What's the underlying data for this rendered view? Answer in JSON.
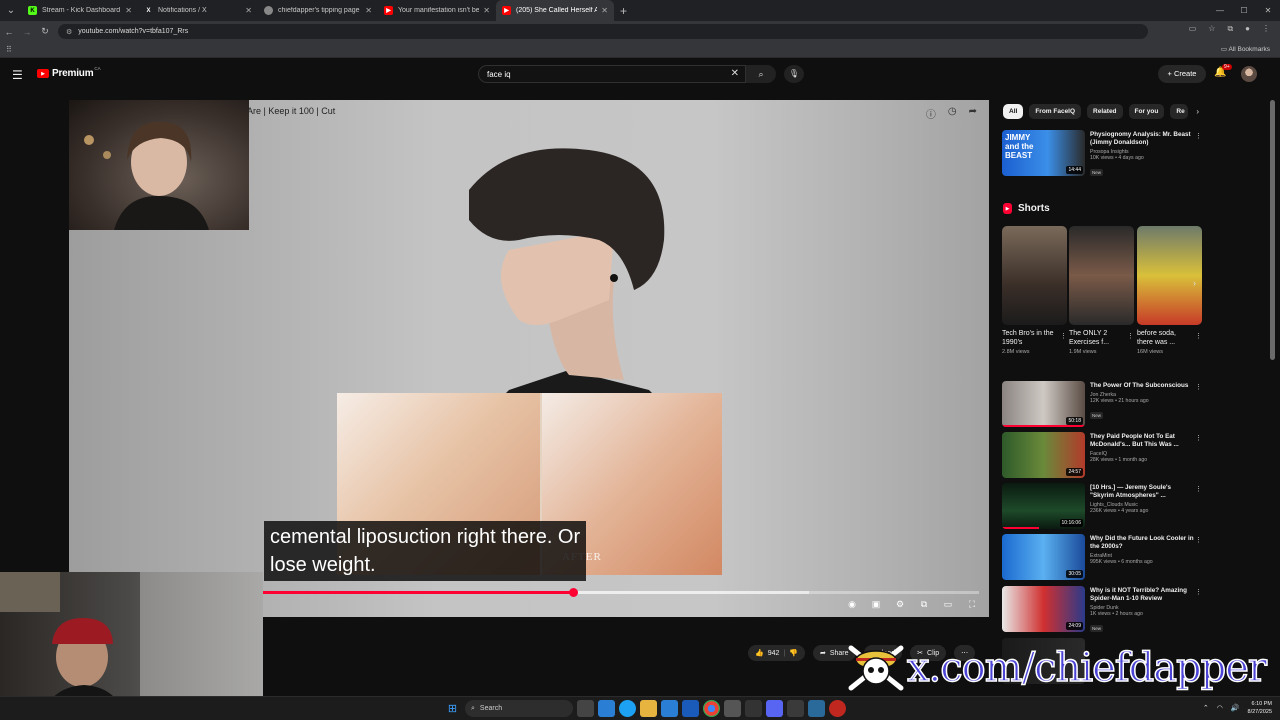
{
  "browser": {
    "tabs": [
      {
        "title": "Stream - Kick Dashboard",
        "icon": "K",
        "color": "#53fc18"
      },
      {
        "title": "Notifications / X",
        "icon": "X",
        "color": "#ffffff"
      },
      {
        "title": "chiefdapper's tipping page",
        "icon": "",
        "color": "#888888"
      },
      {
        "title": "Your manifestation isn't being",
        "icon": "▶",
        "color": "#ff0000"
      },
      {
        "title": "(205) She Called Herself A",
        "icon": "▶",
        "color": "#ff0000"
      }
    ],
    "url": "youtube.com/watch?v=tbfa107_Rrs",
    "all_bookmarks": "All Bookmarks"
  },
  "youtube": {
    "logo_text": "Premium",
    "region": "CA",
    "search_value": "face iq",
    "create_label": "Create",
    "notif_badge": "9+"
  },
  "player": {
    "title_fragment": "Are | Keep it 100 | Cut",
    "caption_line1": "cemental liposuction right there. Or",
    "caption_line2": "lose weight.",
    "after_label": "AFTER",
    "played": 0.433,
    "buffered": 0.33
  },
  "actions": {
    "likes": "942",
    "share": "Share",
    "download": "nload",
    "clip": "Clip"
  },
  "chips": [
    "All",
    "From FaceIQ",
    "Related",
    "For you",
    "Re"
  ],
  "top_rec": {
    "title": "Physiognomy Analysis: Mr. Beast (Jimmy Donaldson)",
    "channel": "Prosopa Insights",
    "meta": "10K views • 4 days ago",
    "badge": "New",
    "duration": "14:44",
    "thumb_text": "JIMMY and the BEAST"
  },
  "shorts": {
    "label": "Shorts",
    "items": [
      {
        "title": "Tech Bro's in the 1990's",
        "views": "2.8M views"
      },
      {
        "title": "The ONLY 2 Exercises f...",
        "views": "1.9M views"
      },
      {
        "title": "before soda, there was ...",
        "views": "16M views"
      }
    ]
  },
  "recs": [
    {
      "title": "The Power Of The Subconscious",
      "channel": "Jon Zherka",
      "meta": "12K views • 21 hours ago",
      "badge": "New",
      "duration": "50:18"
    },
    {
      "title": "They Paid People Not To Eat McDonald's... But This Was ...",
      "channel": "FaceIQ",
      "meta": "28K views • 1 month ago",
      "badge": "",
      "duration": "24:57"
    },
    {
      "title": "[10 Hrs.] — Jeremy Soule's \"Skyrim Atmospheres\" ...",
      "channel": "Lights_Clouds Music",
      "meta": "236K views • 4 years ago",
      "badge": "",
      "duration": "10:16:06"
    },
    {
      "title": "Why Did the Future Look Cooler in the 2000s?",
      "channel": "ExtraMint",
      "meta": "995K views • 6 months ago",
      "badge": "",
      "duration": "30:05"
    },
    {
      "title": "Why is it NOT Terrible? Amazing Spider-Man 1-10 Review",
      "channel": "Spider Dunk",
      "meta": "1K views • 2 hours ago",
      "badge": "New",
      "duration": "24:09"
    }
  ],
  "overlay": {
    "watermark": "x.com/chiefdapper"
  },
  "taskbar": {
    "search": "Search",
    "time": "6:10 PM",
    "date": "8/27/2025"
  }
}
